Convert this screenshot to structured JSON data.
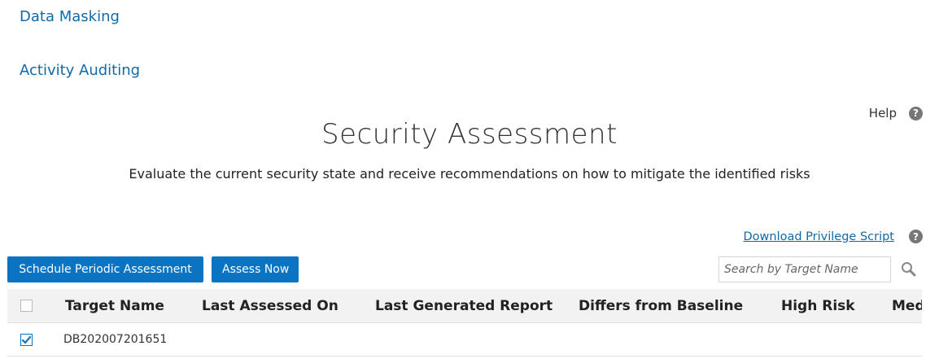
{
  "nav": {
    "items": [
      "Data Masking",
      "Activity Auditing"
    ]
  },
  "help": {
    "label": "Help",
    "icon": "question-circle-icon"
  },
  "header": {
    "title": "Security Assessment",
    "subtitle": "Evaluate the current security state and receive recommendations on how to mitigate the identified risks"
  },
  "download": {
    "label": "Download Privilege Script",
    "icon": "question-circle-icon"
  },
  "toolbar": {
    "schedule_label": "Schedule Periodic Assessment",
    "assess_label": "Assess Now",
    "search_placeholder": "Search by Target Name",
    "search_icon": "magnifier-icon"
  },
  "table": {
    "columns": [
      "Target Name",
      "Last Assessed On",
      "Last Generated Report",
      "Differs from Baseline",
      "High Risk",
      "Med"
    ],
    "rows": [
      {
        "checked": true,
        "target_name": "DB202007201651",
        "last_assessed_on": "",
        "last_generated_report": "",
        "differs_from_baseline": "",
        "high_risk": ""
      }
    ]
  },
  "colors": {
    "link": "#0e6ba8",
    "button": "#0b74c2",
    "header_bg": "#f2f2f2"
  }
}
